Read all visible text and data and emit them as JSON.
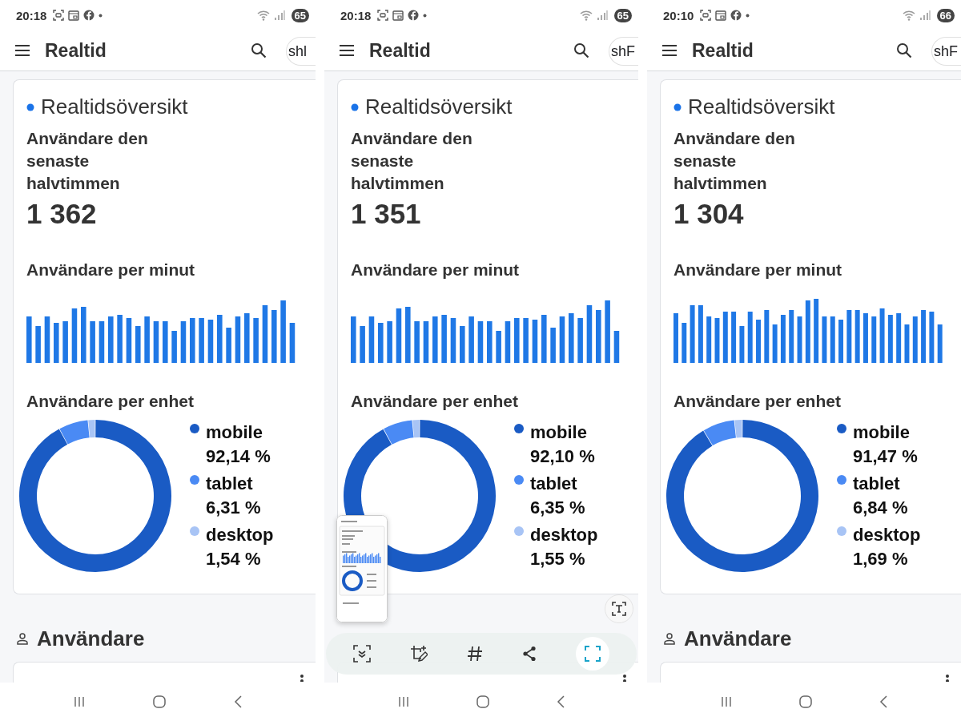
{
  "phones": [
    {
      "status_bar": {
        "time": "20:18",
        "battery": "65"
      },
      "app_bar": {
        "title": "Realtid",
        "avatar": "shl"
      },
      "overview": {
        "title": "Realtidsöversikt",
        "users_label": "Användare den senaste halvtimmen",
        "users_count": "1 362",
        "per_minute_title": "Användare per minut",
        "per_device_title": "Användare per enhet",
        "legend": [
          {
            "value": "92,14 %",
            "color": "#1a5bc4"
          },
          {
            "value": "6,31 %",
            "color": "#4a8af4"
          },
          {
            "value": "1,54 %",
            "color": "#a8c4f5"
          }
        ],
        "chart_data": {
          "type": "donut",
          "categories": [
            "mobile",
            "tablet",
            "desktop"
          ],
          "values": [
            92.14,
            6.31,
            1.54
          ]
        }
      },
      "section": {
        "title": "Användare"
      }
    },
    {
      "status_bar": {
        "time": "20:18",
        "battery": "65"
      },
      "app_bar": {
        "title": "Realtid",
        "avatar": "shF"
      },
      "overview": {
        "title": "Realtidsöversikt",
        "users_label": "Användare den senaste halvtimmen",
        "users_count": "1 351",
        "per_minute_title": "Användare per minut",
        "per_device_title": "Användare per enhet",
        "legend": [
          {
            "value": "92,10 %",
            "color": "#1a5bc4"
          },
          {
            "value": "6,35 %",
            "color": "#4a8af4"
          },
          {
            "value": "1,55 %",
            "color": "#a8c4f5"
          }
        ],
        "chart_data": {
          "type": "donut",
          "categories": [
            "mobile",
            "tablet",
            "desktop"
          ],
          "values": [
            92.1,
            6.35,
            1.55
          ]
        }
      },
      "capture_toolbar": {
        "shown": true
      }
    },
    {
      "status_bar": {
        "time": "20:10",
        "battery": "66"
      },
      "app_bar": {
        "title": "Realtid",
        "avatar": "shF"
      },
      "overview": {
        "title": "Realtidsöversikt",
        "users_label": "Användare den senaste halvtimmen",
        "users_count": "1 304",
        "per_minute_title": "Användare per minut",
        "per_device_title": "Användare per enhet",
        "legend": [
          {
            "value": "91,47 %",
            "color": "#1a5bc4"
          },
          {
            "value": "6,84 %",
            "color": "#4a8af4"
          },
          {
            "value": "1,69 %",
            "color": "#a8c4f5"
          }
        ],
        "chart_data": {
          "type": "donut",
          "categories": [
            "mobile",
            "tablet",
            "desktop"
          ],
          "values": [
            91.47,
            6.84,
            1.69
          ]
        }
      },
      "section": {
        "title": "Användare"
      }
    }
  ]
}
